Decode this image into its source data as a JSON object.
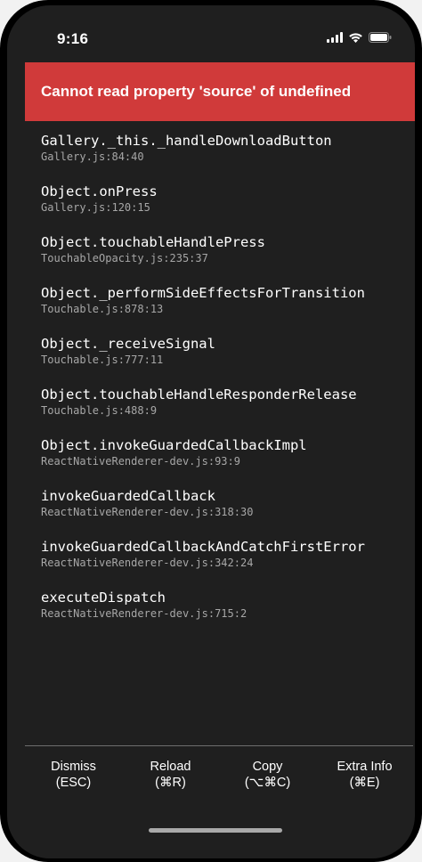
{
  "status_bar": {
    "time": "9:16",
    "icons": [
      "signal-icon",
      "wifi-icon",
      "battery-icon"
    ]
  },
  "error": {
    "message": "Cannot read property 'source' of undefined",
    "color": "#d03a3a"
  },
  "stack_frames": [
    {
      "method": "Gallery._this._handleDownloadButton",
      "location": "Gallery.js:84:40"
    },
    {
      "method": "Object.onPress",
      "location": "Gallery.js:120:15"
    },
    {
      "method": "Object.touchableHandlePress",
      "location": "TouchableOpacity.js:235:37"
    },
    {
      "method": "Object._performSideEffectsForTransition",
      "location": "Touchable.js:878:13"
    },
    {
      "method": "Object._receiveSignal",
      "location": "Touchable.js:777:11"
    },
    {
      "method": "Object.touchableHandleResponderRelease",
      "location": "Touchable.js:488:9"
    },
    {
      "method": "Object.invokeGuardedCallbackImpl",
      "location": "ReactNativeRenderer-dev.js:93:9"
    },
    {
      "method": "invokeGuardedCallback",
      "location": "ReactNativeRenderer-dev.js:318:30"
    },
    {
      "method": "invokeGuardedCallbackAndCatchFirstError",
      "location": "ReactNativeRenderer-dev.js:342:24"
    },
    {
      "method": "executeDispatch",
      "location": "ReactNativeRenderer-dev.js:715:2"
    }
  ],
  "footer": {
    "buttons": [
      {
        "label": "Dismiss",
        "shortcut": "(ESC)"
      },
      {
        "label": "Reload",
        "shortcut": "(⌘R)"
      },
      {
        "label": "Copy",
        "shortcut": "(⌥⌘C)"
      },
      {
        "label": "Extra Info",
        "shortcut": "(⌘E)"
      }
    ]
  }
}
